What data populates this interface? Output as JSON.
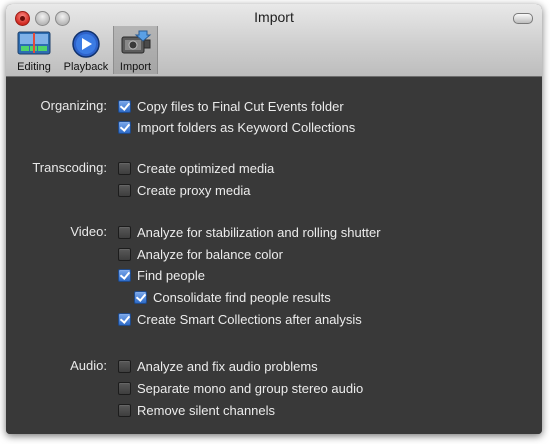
{
  "window": {
    "title": "Import"
  },
  "toolbar": {
    "items": [
      {
        "label": "Editing",
        "icon": "editing-icon"
      },
      {
        "label": "Playback",
        "icon": "playback-icon"
      },
      {
        "label": "Import",
        "icon": "import-icon",
        "selected": true
      }
    ]
  },
  "sections": [
    {
      "label": "Organizing:",
      "options": [
        {
          "label": "Copy files to Final Cut Events folder",
          "checked": true
        },
        {
          "label": "Import folders as Keyword Collections",
          "checked": true
        }
      ]
    },
    {
      "label": "Transcoding:",
      "options": [
        {
          "label": "Create optimized media",
          "checked": false
        },
        {
          "label": "Create proxy media",
          "checked": false
        }
      ]
    },
    {
      "label": "Video:",
      "options": [
        {
          "label": "Analyze for stabilization and rolling shutter",
          "checked": false
        },
        {
          "label": "Analyze for balance color",
          "checked": false
        },
        {
          "label": "Find people",
          "checked": true
        },
        {
          "label": "Consolidate find people results",
          "checked": true
        },
        {
          "label": "Create Smart Collections after analysis",
          "checked": true
        }
      ]
    },
    {
      "label": "Audio:",
      "options": [
        {
          "label": "Analyze and fix audio problems",
          "checked": false
        },
        {
          "label": "Separate mono and group stereo audio",
          "checked": false
        },
        {
          "label": "Remove silent channels",
          "checked": false
        }
      ]
    }
  ],
  "colors": {
    "accent_checkbox": "#2f6cc7",
    "panel_background": "#393939"
  }
}
